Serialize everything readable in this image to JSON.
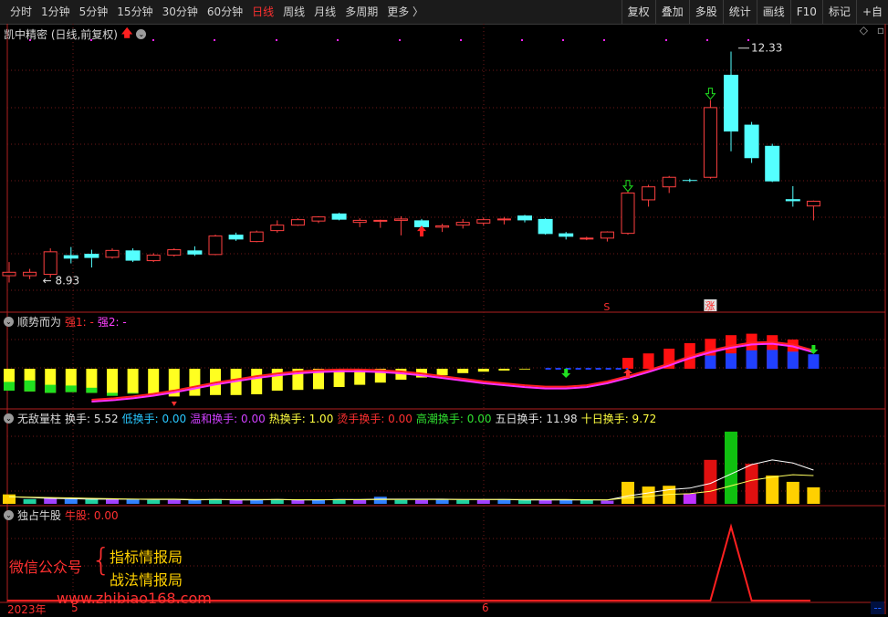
{
  "toolbar": {
    "periods": [
      {
        "label": "分时",
        "active": false
      },
      {
        "label": "1分钟",
        "active": false
      },
      {
        "label": "5分钟",
        "active": false
      },
      {
        "label": "15分钟",
        "active": false
      },
      {
        "label": "30分钟",
        "active": false
      },
      {
        "label": "60分钟",
        "active": false
      },
      {
        "label": "日线",
        "active": true
      },
      {
        "label": "周线",
        "active": false
      },
      {
        "label": "月线",
        "active": false
      },
      {
        "label": "多周期",
        "active": false
      },
      {
        "label": "更多 〉",
        "active": false
      }
    ],
    "right_buttons": [
      "复权",
      "叠加",
      "多股",
      "统计",
      "画线",
      "F10",
      "标记",
      "+自"
    ]
  },
  "main_panel": {
    "title": "凯中精密 (日线,前复权)",
    "high_label": "12.33",
    "low_label": "8.93",
    "signal_s": "S",
    "signal_zhang": "涨"
  },
  "panel2": {
    "title": "顺势而为",
    "q1_label": "强1: -",
    "q2_label": "强2: -"
  },
  "panel3": {
    "title": "无敌量柱",
    "fields": [
      {
        "label": "换手:",
        "value": "5.52",
        "color": "#e0e0e0"
      },
      {
        "label": "低换手:",
        "value": "0.00",
        "color": "#29c8ff"
      },
      {
        "label": "温和换手:",
        "value": "0.00",
        "color": "#d040ff"
      },
      {
        "label": "热换手:",
        "value": "1.00",
        "color": "#ffff40"
      },
      {
        "label": "烫手换手:",
        "value": "0.00",
        "color": "#ff3030"
      },
      {
        "label": "高潮换手:",
        "value": "0.00",
        "color": "#30e030"
      },
      {
        "label": "五日换手:",
        "value": "11.98",
        "color": "#e0e0e0"
      },
      {
        "label": "十日换手:",
        "value": "9.72",
        "color": "#ffff40"
      }
    ]
  },
  "panel4": {
    "title": "独占牛股",
    "field": "牛股: 0.00"
  },
  "watermark": {
    "left": "微信公众号",
    "brace": "{",
    "line1": "指标情报局",
    "line2": "战法情报局",
    "url": "www.zhibiao168.com"
  },
  "axis": {
    "year": "2023年",
    "m5": "5",
    "m6": "6",
    "corner": "--"
  },
  "chart_data": {
    "type": "candlestick",
    "y_range": [
      8.6,
      12.5
    ],
    "high_label_value": 12.33,
    "low_label_value": 8.93,
    "candles": [
      {
        "o": 9.0,
        "c": 9.05,
        "h": 9.2,
        "l": 8.9
      },
      {
        "o": 9.0,
        "c": 9.05,
        "h": 9.1,
        "l": 8.95
      },
      {
        "o": 9.02,
        "c": 9.35,
        "h": 9.4,
        "l": 8.97
      },
      {
        "o": 9.3,
        "c": 9.25,
        "h": 9.42,
        "l": 9.18
      },
      {
        "o": 9.32,
        "c": 9.26,
        "h": 9.38,
        "l": 9.12
      },
      {
        "o": 9.27,
        "c": 9.37,
        "h": 9.4,
        "l": 9.25
      },
      {
        "o": 9.37,
        "c": 9.22,
        "h": 9.4,
        "l": 9.2
      },
      {
        "o": 9.22,
        "c": 9.3,
        "h": 9.33,
        "l": 9.2
      },
      {
        "o": 9.3,
        "c": 9.38,
        "h": 9.4,
        "l": 9.28
      },
      {
        "o": 9.37,
        "c": 9.31,
        "h": 9.43,
        "l": 9.29
      },
      {
        "o": 9.31,
        "c": 9.58,
        "h": 9.6,
        "l": 9.3
      },
      {
        "o": 9.6,
        "c": 9.53,
        "h": 9.63,
        "l": 9.51
      },
      {
        "o": 9.5,
        "c": 9.64,
        "h": 9.66,
        "l": 9.49
      },
      {
        "o": 9.66,
        "c": 9.74,
        "h": 9.81,
        "l": 9.63
      },
      {
        "o": 9.74,
        "c": 9.82,
        "h": 9.84,
        "l": 9.73
      },
      {
        "o": 9.8,
        "c": 9.86,
        "h": 9.87,
        "l": 9.77
      },
      {
        "o": 9.91,
        "c": 9.82,
        "h": 9.92,
        "l": 9.81
      },
      {
        "o": 9.78,
        "c": 9.81,
        "h": 9.84,
        "l": 9.71
      },
      {
        "o": 9.81,
        "c": 9.81,
        "h": 9.82,
        "l": 9.7
      },
      {
        "o": 9.81,
        "c": 9.83,
        "h": 9.87,
        "l": 9.59
      },
      {
        "o": 9.81,
        "c": 9.71,
        "h": 9.83,
        "l": 9.69
      },
      {
        "o": 9.71,
        "c": 9.73,
        "h": 9.76,
        "l": 9.64
      },
      {
        "o": 9.74,
        "c": 9.78,
        "h": 9.83,
        "l": 9.69
      },
      {
        "o": 9.77,
        "c": 9.82,
        "h": 9.85,
        "l": 9.73
      },
      {
        "o": 9.82,
        "c": 9.83,
        "h": 9.86,
        "l": 9.75
      },
      {
        "o": 9.88,
        "c": 9.81,
        "h": 9.89,
        "l": 9.78
      },
      {
        "o": 9.83,
        "c": 9.61,
        "h": 9.84,
        "l": 9.6
      },
      {
        "o": 9.62,
        "c": 9.57,
        "h": 9.64,
        "l": 9.53
      },
      {
        "o": 9.54,
        "c": 9.55,
        "h": 9.57,
        "l": 9.52
      },
      {
        "o": 9.55,
        "c": 9.64,
        "h": 9.65,
        "l": 9.5
      },
      {
        "o": 9.62,
        "c": 10.21,
        "h": 10.23,
        "l": 9.6
      },
      {
        "o": 10.11,
        "c": 10.3,
        "h": 10.33,
        "l": 10.01
      },
      {
        "o": 10.3,
        "c": 10.44,
        "h": 10.46,
        "l": 10.21
      },
      {
        "o": 10.4,
        "c": 10.39,
        "h": 10.42,
        "l": 10.37
      },
      {
        "o": 10.44,
        "c": 11.46,
        "h": 11.57,
        "l": 10.42
      },
      {
        "o": 11.94,
        "c": 11.11,
        "h": 12.28,
        "l": 10.82
      },
      {
        "o": 11.21,
        "c": 10.72,
        "h": 11.25,
        "l": 10.65
      },
      {
        "o": 10.9,
        "c": 10.38,
        "h": 10.93,
        "l": 10.37
      },
      {
        "o": 10.12,
        "c": 10.09,
        "h": 10.31,
        "l": 10.01
      },
      {
        "o": 10.02,
        "c": 10.09,
        "h": 10.1,
        "l": 9.81
      }
    ],
    "arrows": [
      {
        "index": 20,
        "dir": "up",
        "price": 9.6,
        "color": "#ff2020"
      },
      {
        "index": 30,
        "dir": "down",
        "price": 10.26,
        "color": "#20e020"
      },
      {
        "index": 34,
        "dir": "down",
        "price": 11.61,
        "color": "#20e020"
      }
    ],
    "trend_oscillator": {
      "yellow": [
        0.6,
        0.62,
        0.66,
        0.64,
        0.66,
        0.74,
        0.68,
        0.7,
        0.76,
        0.74,
        0.72,
        0.72,
        0.7,
        0.6,
        0.58,
        0.56,
        0.5,
        0.44,
        0.38,
        0.3,
        0.24,
        0.18,
        0.12,
        0.08,
        0.05,
        0.02
      ],
      "green": [
        0.24,
        0.3,
        0.22,
        0.18,
        0.14,
        0.08,
        0.02,
        0.0,
        0.0,
        0.0,
        0.0,
        0.0,
        0.0,
        0.0,
        0.0,
        0.0,
        0.0,
        0.0,
        0.0,
        0.0,
        0.0,
        0.0,
        0.0,
        0.0,
        0.0,
        0.0
      ],
      "line": [
        0.0,
        0.02,
        0.05,
        0.09,
        0.14,
        0.2,
        0.26,
        0.31,
        0.36,
        0.4,
        0.43,
        0.45,
        0.46,
        0.46,
        0.45,
        0.43,
        0.4,
        0.36,
        0.32,
        0.28,
        0.25,
        0.22,
        0.2,
        0.2,
        0.22,
        0.28,
        0.36,
        0.45,
        0.55,
        0.66,
        0.75,
        0.82,
        0.87,
        0.88,
        0.84,
        0.75
      ],
      "line_start": 8,
      "red_up": [
        0.0,
        0.0,
        0.0,
        0.0,
        0.0,
        0.0,
        0.0,
        0.0,
        0.0,
        0.0,
        0.0,
        0.0,
        0.0,
        0.0,
        0.0,
        0.0,
        0.0,
        0.0,
        0.0,
        0.0,
        0.0,
        0.0,
        0.0,
        0.0,
        0.0,
        0.0,
        0.0,
        0.0,
        0.0,
        0.0,
        0.3,
        0.42,
        0.55,
        0.7,
        0.82,
        0.92,
        0.96,
        0.92,
        0.8,
        0.0
      ],
      "blue_down": [
        0.0,
        0.0,
        0.0,
        0.0,
        0.0,
        0.0,
        0.0,
        0.0,
        0.0,
        0.0,
        0.0,
        0.0,
        0.0,
        0.0,
        0.0,
        0.0,
        0.0,
        0.0,
        0.0,
        0.0,
        0.0,
        0.0,
        0.0,
        0.0,
        0.0,
        0.0,
        0.0,
        0.0,
        0.0,
        0.0,
        0.0,
        0.0,
        0.0,
        0.0,
        0.6,
        0.7,
        0.84,
        0.86,
        0.78,
        0.66
      ]
    },
    "volume": {
      "values": [
        1.2,
        0.6,
        0.7,
        0.6,
        0.6,
        0.6,
        0.6,
        0.5,
        0.5,
        0.5,
        0.6,
        0.5,
        0.5,
        0.6,
        0.5,
        0.5,
        0.6,
        0.5,
        0.9,
        0.5,
        0.5,
        0.6,
        0.5,
        0.5,
        0.6,
        0.5,
        0.5,
        0.5,
        0.5,
        0.4,
        2.8,
        2.2,
        2.3,
        1.3,
        5.6,
        9.2,
        5.1,
        3.6,
        2.8,
        2.1
      ],
      "ma5": [
        0.9,
        0.8,
        0.7,
        0.65,
        0.6,
        0.6,
        0.6,
        0.55,
        0.55,
        0.5,
        0.55,
        0.5,
        0.5,
        0.55,
        0.5,
        0.5,
        0.55,
        0.55,
        0.6,
        0.6,
        0.6,
        0.6,
        0.55,
        0.55,
        0.55,
        0.5,
        0.5,
        0.5,
        0.5,
        0.5,
        1.0,
        1.4,
        1.8,
        2.0,
        2.6,
        3.8,
        5.0,
        5.6,
        5.2,
        4.3
      ],
      "ma10": [
        0.9,
        0.85,
        0.8,
        0.75,
        0.7,
        0.65,
        0.6,
        0.6,
        0.6,
        0.55,
        0.55,
        0.55,
        0.55,
        0.55,
        0.52,
        0.52,
        0.52,
        0.52,
        0.55,
        0.55,
        0.55,
        0.55,
        0.55,
        0.55,
        0.55,
        0.55,
        0.55,
        0.55,
        0.52,
        0.5,
        0.75,
        0.95,
        1.2,
        1.3,
        1.6,
        2.3,
        3.0,
        3.4,
        3.7,
        3.6
      ],
      "max": 10
    },
    "bull_signal": {
      "index": 35,
      "value": 1
    }
  }
}
